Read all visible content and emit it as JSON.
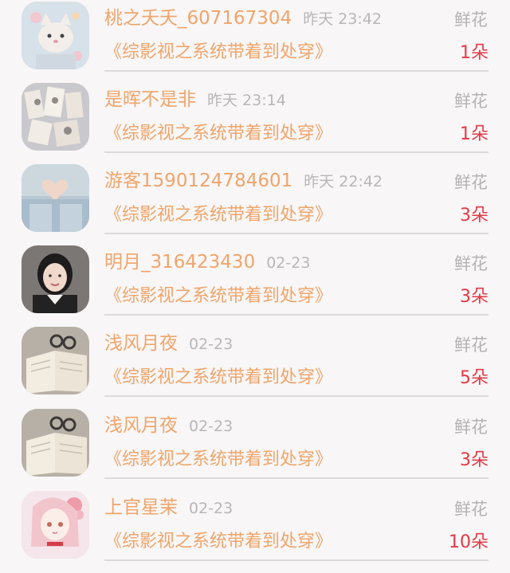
{
  "gifts": [
    {
      "name": "桃之夭夭_607167304",
      "time": "昨天 23:42",
      "type": "鲜花",
      "book": "《综影视之系统带着到处穿》",
      "count": "1朵",
      "avatar_icon": "cat-avatar-icon"
    },
    {
      "name": "是晖不是非",
      "time": "昨天 23:14",
      "type": "鲜花",
      "book": "《综影视之系统带着到处穿》",
      "count": "1朵",
      "avatar_icon": "collage-avatar-icon"
    },
    {
      "name": "游客1590124784601",
      "time": "昨天 22:42",
      "type": "鲜花",
      "book": "《综影视之系统带着到处穿》",
      "count": "3朵",
      "avatar_icon": "heart-hands-avatar-icon"
    },
    {
      "name": "明月_316423430",
      "time": "02-23",
      "type": "鲜花",
      "book": "《综影视之系统带着到处穿》",
      "count": "3朵",
      "avatar_icon": "girl-portrait-avatar-icon"
    },
    {
      "name": "浅风月夜",
      "time": "02-23",
      "type": "鲜花",
      "book": "《综影视之系统带着到处穿》",
      "count": "5朵",
      "avatar_icon": "open-book-avatar-icon"
    },
    {
      "name": "浅风月夜",
      "time": "02-23",
      "type": "鲜花",
      "book": "《综影视之系统带着到处穿》",
      "count": "3朵",
      "avatar_icon": "open-book-avatar-icon"
    },
    {
      "name": "上官星茉",
      "time": "02-23",
      "type": "鲜花",
      "book": "《综影视之系统带着到处穿》",
      "count": "10朵",
      "avatar_icon": "anime-girl-avatar-icon"
    }
  ],
  "colors": {
    "name": "#f0a56a",
    "time": "#b9b6b7",
    "count": "#e23a46",
    "background": "#f8f6f7"
  }
}
